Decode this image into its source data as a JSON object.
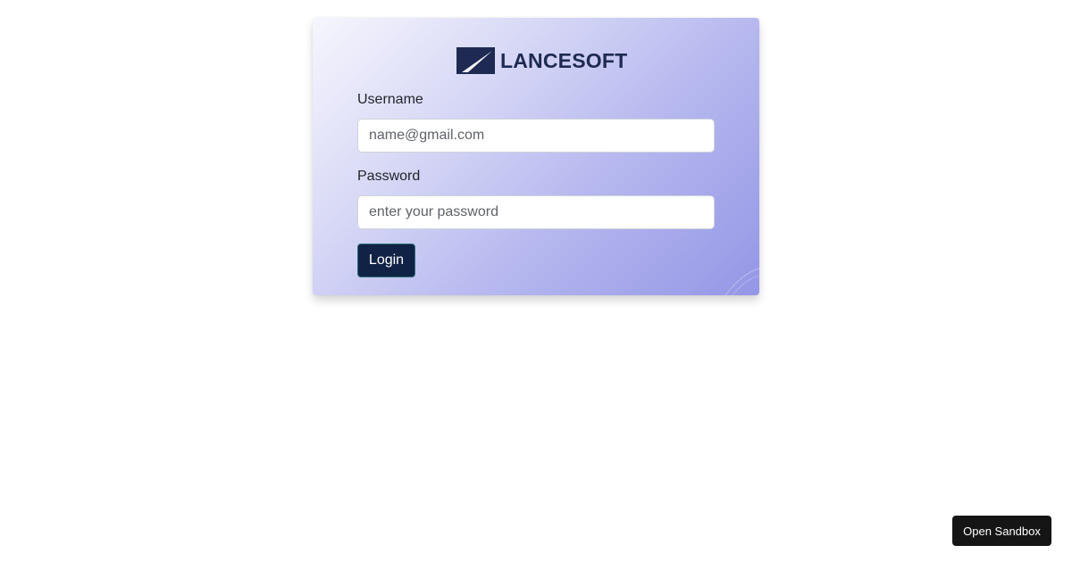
{
  "brand": {
    "name": "LANCESOFT",
    "icon": "lancesoft-logo-mark"
  },
  "form": {
    "username_label": "Username",
    "username_placeholder": "name@gmail.com",
    "username_value": "",
    "password_label": "Password",
    "password_placeholder": "enter your password",
    "password_value": "",
    "submit_label": "Login"
  },
  "sandbox": {
    "button_label": "Open Sandbox"
  },
  "colors": {
    "brand_navy": "#1e2a52",
    "login_button_bg": "#102347",
    "card_gradient_start": "#f6f6fd",
    "card_gradient_end": "#9496e6",
    "sandbox_button_bg": "#151515"
  }
}
